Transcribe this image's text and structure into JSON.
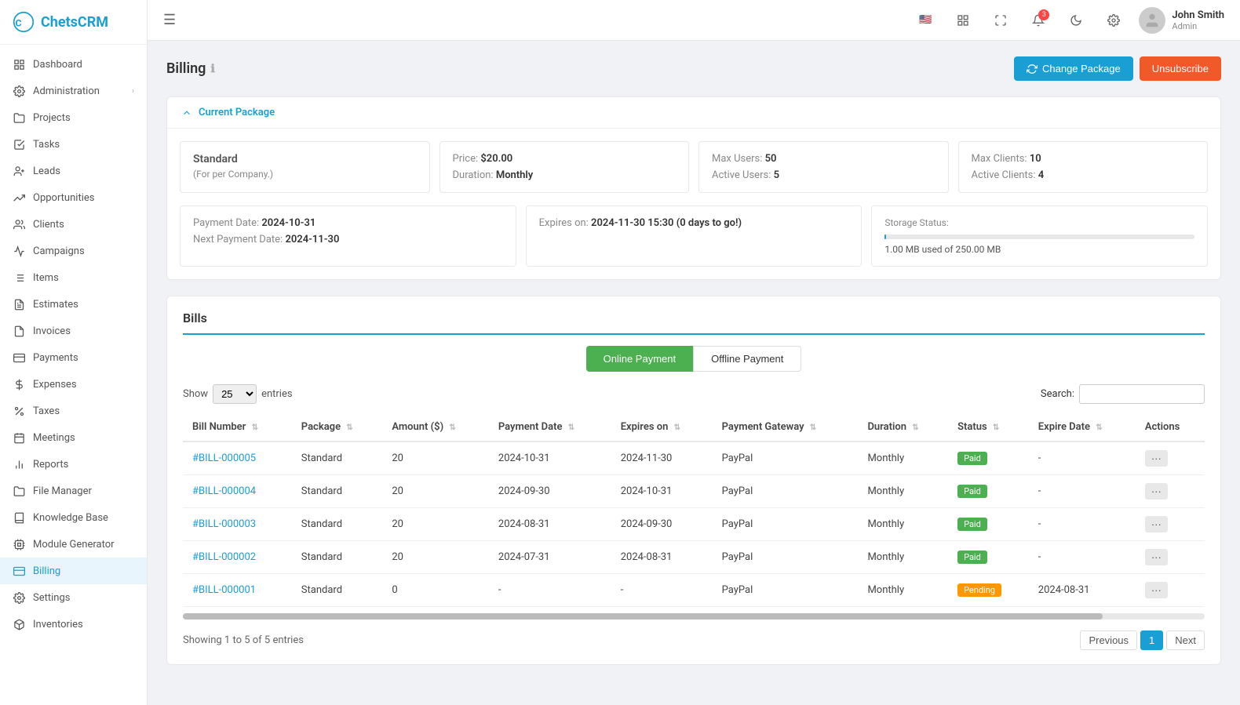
{
  "app": {
    "name": "ChetsCRM",
    "logo_color": "#1a9fd4"
  },
  "sidebar": {
    "items": [
      {
        "id": "dashboard",
        "label": "Dashboard",
        "icon": "grid-icon",
        "active": false
      },
      {
        "id": "administration",
        "label": "Administration",
        "icon": "settings-icon",
        "active": false,
        "has_arrow": true
      },
      {
        "id": "projects",
        "label": "Projects",
        "icon": "folder-icon",
        "active": false
      },
      {
        "id": "tasks",
        "label": "Tasks",
        "icon": "check-square-icon",
        "active": false
      },
      {
        "id": "leads",
        "label": "Leads",
        "icon": "user-plus-icon",
        "active": false
      },
      {
        "id": "opportunities",
        "label": "Opportunities",
        "icon": "trending-icon",
        "active": false
      },
      {
        "id": "clients",
        "label": "Clients",
        "icon": "users-icon",
        "active": false
      },
      {
        "id": "campaigns",
        "label": "Campaigns",
        "icon": "megaphone-icon",
        "active": false
      },
      {
        "id": "items",
        "label": "Items",
        "icon": "package-icon",
        "active": false
      },
      {
        "id": "estimates",
        "label": "Estimates",
        "icon": "file-text-icon",
        "active": false
      },
      {
        "id": "invoices",
        "label": "Invoices",
        "icon": "file-icon",
        "active": false
      },
      {
        "id": "payments",
        "label": "Payments",
        "icon": "credit-card-icon",
        "active": false
      },
      {
        "id": "expenses",
        "label": "Expenses",
        "icon": "dollar-icon",
        "active": false
      },
      {
        "id": "taxes",
        "label": "Taxes",
        "icon": "percent-icon",
        "active": false
      },
      {
        "id": "meetings",
        "label": "Meetings",
        "icon": "calendar-icon",
        "active": false
      },
      {
        "id": "reports",
        "label": "Reports",
        "icon": "bar-chart-icon",
        "active": false
      },
      {
        "id": "file-manager",
        "label": "File Manager",
        "icon": "folder2-icon",
        "active": false
      },
      {
        "id": "knowledge-base",
        "label": "Knowledge Base",
        "icon": "book-icon",
        "active": false
      },
      {
        "id": "module-generator",
        "label": "Module Generator",
        "icon": "cpu-icon",
        "active": false
      },
      {
        "id": "billing",
        "label": "Billing",
        "icon": "billing-icon",
        "active": true
      },
      {
        "id": "settings",
        "label": "Settings",
        "icon": "gear-icon",
        "active": false
      },
      {
        "id": "inventories",
        "label": "Inventories",
        "icon": "box-icon",
        "active": false
      }
    ]
  },
  "topbar": {
    "hamburger_label": "☰",
    "flag": "🇺🇸",
    "grid_icon": "⊞",
    "fullscreen_icon": "⛶",
    "notification_count": "3",
    "moon_icon": "☽",
    "settings_icon": "⚙",
    "user": {
      "name": "John Smith",
      "role": "Admin"
    }
  },
  "page": {
    "title": "Billing",
    "change_package_label": "Change Package",
    "unsubscribe_label": "Unsubscribe"
  },
  "current_package": {
    "section_label": "Current Package",
    "package_name": "Standard",
    "package_desc": "(For per Company.)",
    "price_label": "Price:",
    "price_value": "$20.00",
    "duration_label": "Duration:",
    "duration_value": "Monthly",
    "max_users_label": "Max Users:",
    "max_users_value": "50",
    "active_users_label": "Active Users:",
    "active_users_value": "5",
    "max_clients_label": "Max Clients:",
    "max_clients_value": "10",
    "active_clients_label": "Active Clients:",
    "active_clients_value": "4",
    "payment_date_label": "Payment Date:",
    "payment_date_value": "2024-10-31",
    "next_payment_label": "Next Payment Date:",
    "next_payment_value": "2024-11-30",
    "expires_label": "Expires on:",
    "expires_value": "2024-11-30 15:30 (0 days to go!)",
    "storage_label": "Storage Status:",
    "storage_used": "1.00 MB used of 250.00 MB",
    "storage_percent": 0.4
  },
  "bills": {
    "title": "Bills",
    "online_payment_label": "Online Payment",
    "offline_payment_label": "Offline Payment",
    "show_label": "Show",
    "entries_label": "entries",
    "show_value": "25",
    "search_label": "Search:",
    "search_placeholder": "",
    "columns": [
      "Bill Number",
      "Package",
      "Amount ($)",
      "Payment Date",
      "Expires on",
      "Payment Gateway",
      "Duration",
      "Status",
      "Expire Date",
      "Actions"
    ],
    "rows": [
      {
        "bill_number": "#BILL-000005",
        "package": "Standard",
        "amount": "20",
        "payment_date": "2024-10-31",
        "expires_on": "2024-11-30",
        "gateway": "PayPal",
        "duration": "Monthly",
        "status": "Paid",
        "expire_date": "-"
      },
      {
        "bill_number": "#BILL-000004",
        "package": "Standard",
        "amount": "20",
        "payment_date": "2024-09-30",
        "expires_on": "2024-10-31",
        "gateway": "PayPal",
        "duration": "Monthly",
        "status": "Paid",
        "expire_date": "-"
      },
      {
        "bill_number": "#BILL-000003",
        "package": "Standard",
        "amount": "20",
        "payment_date": "2024-08-31",
        "expires_on": "2024-09-30",
        "gateway": "PayPal",
        "duration": "Monthly",
        "status": "Paid",
        "expire_date": "-"
      },
      {
        "bill_number": "#BILL-000002",
        "package": "Standard",
        "amount": "20",
        "payment_date": "2024-07-31",
        "expires_on": "2024-08-31",
        "gateway": "PayPal",
        "duration": "Monthly",
        "status": "Paid",
        "expire_date": "-"
      },
      {
        "bill_number": "#BILL-000001",
        "package": "Standard",
        "amount": "0",
        "payment_date": "-",
        "expires_on": "-",
        "gateway": "PayPal",
        "duration": "Monthly",
        "status": "Pending",
        "expire_date": "2024-08-31"
      }
    ],
    "pagination": {
      "showing_label": "Showing 1 to 5 of 5 entries",
      "previous_label": "Previous",
      "next_label": "Next",
      "current_page": "1"
    }
  }
}
